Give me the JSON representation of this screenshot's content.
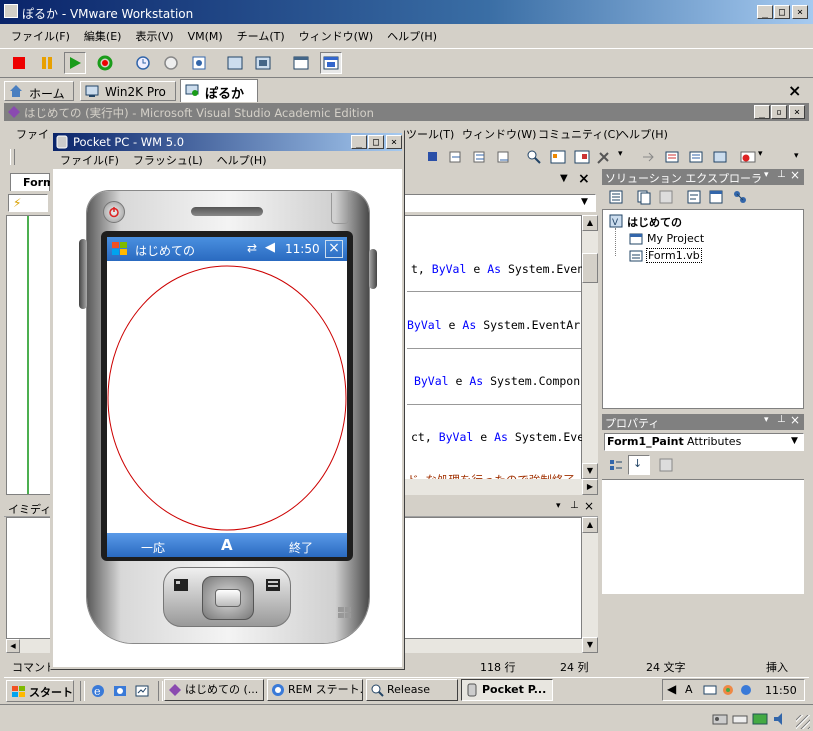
{
  "vmware": {
    "title": "ぽるか - VMware Workstation",
    "menu": [
      "ファイル(F)",
      "編集(E)",
      "表示(V)",
      "VM(M)",
      "チーム(T)",
      "ウィンドウ(W)",
      "ヘルプ(H)"
    ],
    "tabs": [
      {
        "label": "ホーム",
        "icon": "home-icon"
      },
      {
        "label": "Win2K Pro",
        "icon": "vm-icon"
      },
      {
        "label": "ぽるか",
        "icon": "vm-icon",
        "active": true
      }
    ]
  },
  "vs": {
    "title": "はじめての (実行中) - Microsoft Visual Studio Academic Edition",
    "menu_visible": [
      "ファイル",
      "ツール(T)",
      "ウィンドウ(W)",
      "コミュニティ(C)",
      "ヘルプ(H)"
    ],
    "doc_tab": "Form",
    "code_lines": [
      {
        "plain": "t, ",
        "kw": "ByVal",
        "rest": " e ",
        "kw2": "As",
        "rest2": " System.Even"
      },
      {
        "plain": "",
        "kw": "ByVal",
        "rest": " e ",
        "kw2": "As",
        "rest2": " System.EventAr"
      },
      {
        "plain": " ",
        "kw": "ByVal",
        "rest": " e ",
        "kw2": "As",
        "rest2": " System.Compon"
      },
      {
        "plain": "ct, ",
        "kw": "ByVal",
        "rest": " e ",
        "kw2": "As",
        "rest2": " System.Eve"
      }
    ],
    "comment_line": "ド な処理を行ったので強制終了",
    "immediate_title": "イミディエ",
    "command_label": "コマンド",
    "status": {
      "line": "118 行",
      "col": "24 列",
      "char": "24 文字",
      "mode": "挿入"
    }
  },
  "solution_explorer": {
    "title": "ソリューション エクスプローラ",
    "project": "はじめての",
    "items": [
      "My Project",
      "Form1.vb"
    ]
  },
  "properties": {
    "title": "プロパティ",
    "object": "Form1_Paint",
    "object_type": "Attributes"
  },
  "pocketpc": {
    "title": "Pocket PC - WM 5.0",
    "menu": [
      "ファイル(F)",
      "フラッシュ(L)",
      "ヘルプ(H)"
    ],
    "device": {
      "app_title": "はじめての",
      "time": "11:50",
      "softkey_left": "一応",
      "softkey_mid": "A",
      "softkey_right": "終了"
    }
  },
  "taskbar": {
    "start": "スタート",
    "buttons": [
      "はじめての (...",
      "REM ステート...",
      "Release",
      "Pocket P..."
    ],
    "clock": "11:50",
    "ime": "A"
  },
  "colors": {
    "titlebar_active": "#0a246a",
    "titlebar_inactive": "#808080",
    "face": "#d4d0c8",
    "keyword": "#0000ff",
    "ellipse": "#cc0000",
    "ppc_titlebar": "#3b7fd0"
  }
}
